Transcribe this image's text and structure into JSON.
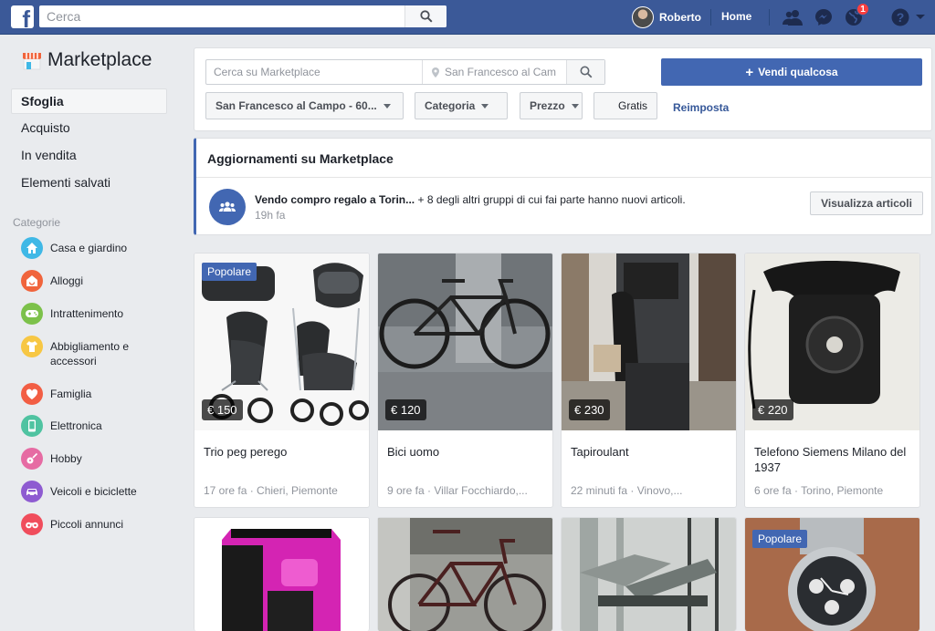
{
  "topbar": {
    "logo_letter": "f",
    "search_placeholder": "Cerca",
    "user_name": "Roberto",
    "home_label": "Home",
    "notification_count": "1"
  },
  "sidebar": {
    "title": "Marketplace",
    "nav": [
      {
        "label": "Sfoglia"
      },
      {
        "label": "Acquisto"
      },
      {
        "label": "In vendita"
      },
      {
        "label": "Elementi salvati"
      }
    ],
    "categories_header": "Categorie",
    "categories": [
      {
        "label": "Casa e giardino",
        "color": "#3fb8e6",
        "icon": "house-icon"
      },
      {
        "label": "Alloggi",
        "color": "#f0643c",
        "icon": "building-icon"
      },
      {
        "label": "Intrattenimento",
        "color": "#7cc14a",
        "icon": "gamepad-icon"
      },
      {
        "label": "Abbigliamento e accessori",
        "color": "#f7c744",
        "icon": "shirt-icon"
      },
      {
        "label": "Famiglia",
        "color": "#f25e44",
        "icon": "heart-icon"
      },
      {
        "label": "Elettronica",
        "color": "#4fc3a1",
        "icon": "phone-icon"
      },
      {
        "label": "Hobby",
        "color": "#e66ba3",
        "icon": "guitar-icon"
      },
      {
        "label": "Veicoli e biciclette",
        "color": "#8e5bd1",
        "icon": "car-icon"
      },
      {
        "label": "Piccoli annunci",
        "color": "#f04d5c",
        "icon": "binoculars-icon"
      }
    ]
  },
  "filters": {
    "search_placeholder": "Cerca su Marketplace",
    "location_placeholder": "San Francesco al Cam",
    "sell_label": "Vendi qualcosa",
    "location_chip": "San Francesco al Campo - 60...",
    "category_chip": "Categoria",
    "price_chip": "Prezzo",
    "free_chip": "Gratis",
    "reset_label": "Reimposta"
  },
  "updates": {
    "title": "Aggiornamenti su Marketplace",
    "group_name": "Vendo compro regalo a Torin...",
    "message": " + 8 degli altri gruppi di cui fai parte hanno nuovi articoli.",
    "time": "19h fa",
    "view_label": "Visualizza articoli"
  },
  "listings": [
    {
      "badge": "Popolare",
      "price": "€ 150",
      "title": "Trio peg perego",
      "meta": "17 ore fa · Chieri, Piemonte"
    },
    {
      "badge": "",
      "price": "€ 120",
      "title": "Bici uomo",
      "meta": "9 ore fa · Villar Focchiardo,..."
    },
    {
      "badge": "",
      "price": "€ 230",
      "title": "Tapiroulant",
      "meta": "22 minuti fa · Vinovo,..."
    },
    {
      "badge": "",
      "price": "€ 220",
      "title": "Telefono Siemens Milano del 1937",
      "meta": "6 ore fa · Torino, Piemonte"
    },
    {
      "badge": "",
      "price": "",
      "title": "",
      "meta": ""
    },
    {
      "badge": "",
      "price": "",
      "title": "",
      "meta": ""
    },
    {
      "badge": "",
      "price": "",
      "title": "",
      "meta": ""
    },
    {
      "badge": "Popolare",
      "price": "",
      "title": "",
      "meta": ""
    }
  ]
}
